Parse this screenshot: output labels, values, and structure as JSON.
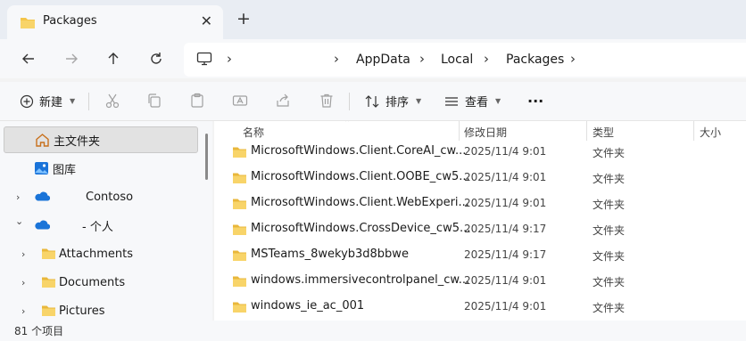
{
  "tab": {
    "title": "Packages",
    "close": "✕",
    "new_tab": "+"
  },
  "address": {
    "crumbs": [
      "AppData",
      "Local",
      "Packages"
    ],
    "separator": "›"
  },
  "toolbar": {
    "new_label": "新建",
    "sort_label": "排序",
    "view_label": "查看",
    "more_label": "···"
  },
  "nav": {
    "items": [
      {
        "label": "主文件夹",
        "icon": "home-icon",
        "selected": true
      },
      {
        "label": "图库",
        "icon": "gallery-icon"
      },
      {
        "label": "Contoso",
        "icon": "onedrive-icon",
        "chevron": "›"
      },
      {
        "label": "- 个人",
        "icon": "onedrive-icon",
        "chevron": "⌄"
      },
      {
        "label": "Attachments",
        "icon": "folder-icon",
        "chevron": "›"
      },
      {
        "label": "Documents",
        "icon": "folder-icon",
        "chevron": "›"
      },
      {
        "label": "Pictures",
        "icon": "folder-icon",
        "chevron": "›"
      }
    ]
  },
  "columns": {
    "name": "名称",
    "date": "修改日期",
    "type": "类型",
    "size": "大小"
  },
  "files": [
    {
      "name": "MicrosoftWindows.Client.CoreAI_cw...",
      "date": "2025/11/4 9:01",
      "type": "文件夹"
    },
    {
      "name": "MicrosoftWindows.Client.OOBE_cw5...",
      "date": "2025/11/4 9:01",
      "type": "文件夹"
    },
    {
      "name": "MicrosoftWindows.Client.WebExperi...",
      "date": "2025/11/4 9:01",
      "type": "文件夹"
    },
    {
      "name": "MicrosoftWindows.CrossDevice_cw5...",
      "date": "2025/11/4 9:17",
      "type": "文件夹"
    },
    {
      "name": "MSTeams_8wekyb3d8bbwe",
      "date": "2025/11/4 9:17",
      "type": "文件夹"
    },
    {
      "name": "windows.immersivecontrolpanel_cw...",
      "date": "2025/11/4 9:01",
      "type": "文件夹"
    },
    {
      "name": "windows_ie_ac_001",
      "date": "2025/11/4 9:01",
      "type": "文件夹"
    }
  ],
  "status": {
    "item_count": "81 个项目"
  },
  "colors": {
    "folder": "#f4c54a",
    "accent": "#0067c0"
  }
}
